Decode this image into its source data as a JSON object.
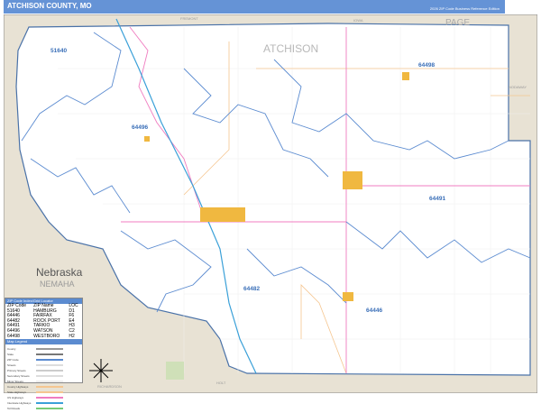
{
  "header": {
    "title": "ATCHISON COUNTY, MO",
    "edition": "2026 ZIP Code Business Reference Edition",
    "logo": "Market MAPS"
  },
  "map": {
    "county_label": "ATCHISON",
    "neighbors": [
      {
        "name": "FREMONT"
      },
      {
        "name": "IOWA"
      },
      {
        "name": "PAGE"
      },
      {
        "name": "NODAWAY"
      },
      {
        "name": "HOLT"
      },
      {
        "name": "RICHARDSON"
      },
      {
        "name": "Nebraska"
      },
      {
        "name": "NEMAHA"
      }
    ],
    "zip_labels": [
      "51640",
      "64498",
      "64496",
      "64491",
      "64482",
      "64446"
    ],
    "colors": {
      "land": "#ffffff",
      "outside": "#e8e2d4",
      "zip_boundary": "#5b8bd0",
      "highway": "#f07cc0",
      "interstate": "#3aa0d8",
      "road": "#f5c690",
      "city": "#f0b840"
    }
  },
  "legend": {
    "title": "ZIP Code Index/Grid Locator",
    "columns": [
      "ZIP Code",
      "ZIP Name",
      "LOC"
    ],
    "rows": [
      [
        "51640",
        "HAMBURG",
        "D1"
      ],
      [
        "64446",
        "FAIRFAX",
        "F6"
      ],
      [
        "64482",
        "ROCK PORT",
        "E4"
      ],
      [
        "64491",
        "TARKIO",
        "H3"
      ],
      [
        "64496",
        "WATSON",
        "C2"
      ],
      [
        "64498",
        "WESTBORO",
        "H2"
      ]
    ],
    "key_title": "Map Legend",
    "keys": [
      "County",
      "State",
      "ZIP Code",
      "Streets",
      "Primary Streets",
      "Secondary Streets",
      "Minor Streets",
      "County Highways",
      "State Highways",
      "US Highways",
      "Interstate Highways",
      "Toll Roads"
    ]
  }
}
